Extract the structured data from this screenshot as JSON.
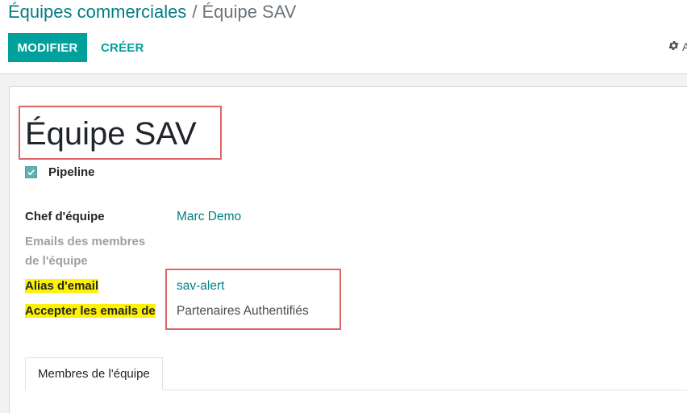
{
  "breadcrumb": {
    "parent": "Équipes commerciales",
    "separator": "/",
    "current": "Équipe SAV"
  },
  "toolbar": {
    "edit_label": "MODIFIER",
    "create_label": "CRÉER",
    "action_label": "A",
    "action_icon": "gear-icon"
  },
  "record": {
    "title": "Équipe SAV",
    "pipeline": {
      "label": "Pipeline",
      "checked": true
    }
  },
  "fields": {
    "team_leader": {
      "label": "Chef d'équipe",
      "value": "Marc Demo"
    },
    "member_emails": {
      "label": "Emails des membres de l'équipe",
      "value": ""
    },
    "email_alias": {
      "label": "Alias d'email",
      "value": "sav-alert"
    },
    "accept_emails_from": {
      "label": "Accepter les emails de",
      "value": "Partenaires Authentifiés"
    }
  },
  "tabs": [
    {
      "label": "Membres de l'équipe",
      "active": true
    }
  ],
  "colors": {
    "primary": "#00a09d",
    "link": "#017e84",
    "highlight_yellow": "#fff200",
    "annotation_red": "#e06666"
  }
}
